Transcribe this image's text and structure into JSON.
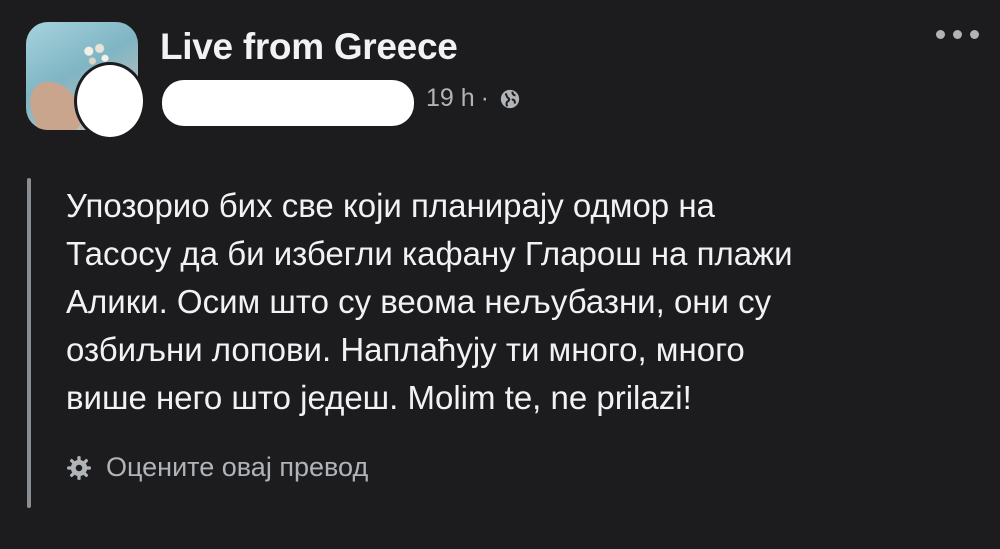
{
  "post": {
    "group_name": "Live from Greece",
    "timestamp": "19 h",
    "separator": "·",
    "privacy_icon": "globe-icon",
    "menu_icon": "more-icon",
    "text_lines": [
      "Упозорио бих све који планирају одмор на",
      "Тасосу да би избегли кафану Гларош на плажи",
      "Алики. Осим што су веома нељубазни, они су",
      "озбиљни лопови. Наплаћују ти много, много",
      "више него што једеш. Molim te, ne prilazi!"
    ],
    "rate_translation_label": "Оцените овај превод",
    "rate_translation_icon": "gear-icon"
  },
  "colors": {
    "background": "#1c1c1e",
    "primary_text": "#f0f2f5",
    "secondary_text": "#b0b3b8"
  }
}
